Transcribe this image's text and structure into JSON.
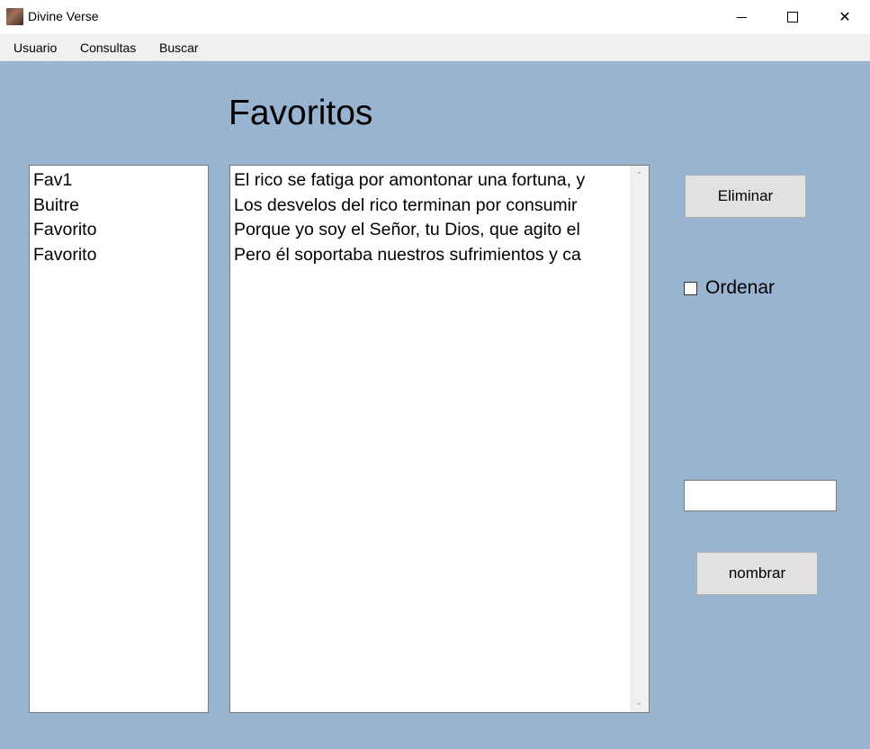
{
  "window": {
    "title": "Divine Verse",
    "minimize_glyph": "",
    "close_glyph": "✕"
  },
  "menu": {
    "items": [
      "Usuario",
      "Consultas",
      "Buscar"
    ]
  },
  "page": {
    "heading": "Favoritos"
  },
  "favorites_list": {
    "items": [
      "Fav1",
      "Buitre",
      "Favorito",
      "Favorito"
    ]
  },
  "verses": {
    "lines": [
      "El rico se fatiga por amontonar una fortuna, y",
      "Los desvelos del rico terminan por consumir",
      "Porque yo soy el Señor, tu Dios, que agito el",
      "Pero él soportaba nuestros sufrimientos y ca"
    ],
    "scroll_up_glyph": "⌃",
    "scroll_down_glyph": "⌄"
  },
  "actions": {
    "eliminar_label": "Eliminar",
    "ordenar_label": "Ordenar",
    "ordenar_checked": false,
    "name_value": "",
    "nombrar_label": "nombrar"
  },
  "icons": {
    "app": "app-icon",
    "minimize": "minimize-icon",
    "maximize": "maximize-icon",
    "close": "close-icon"
  }
}
